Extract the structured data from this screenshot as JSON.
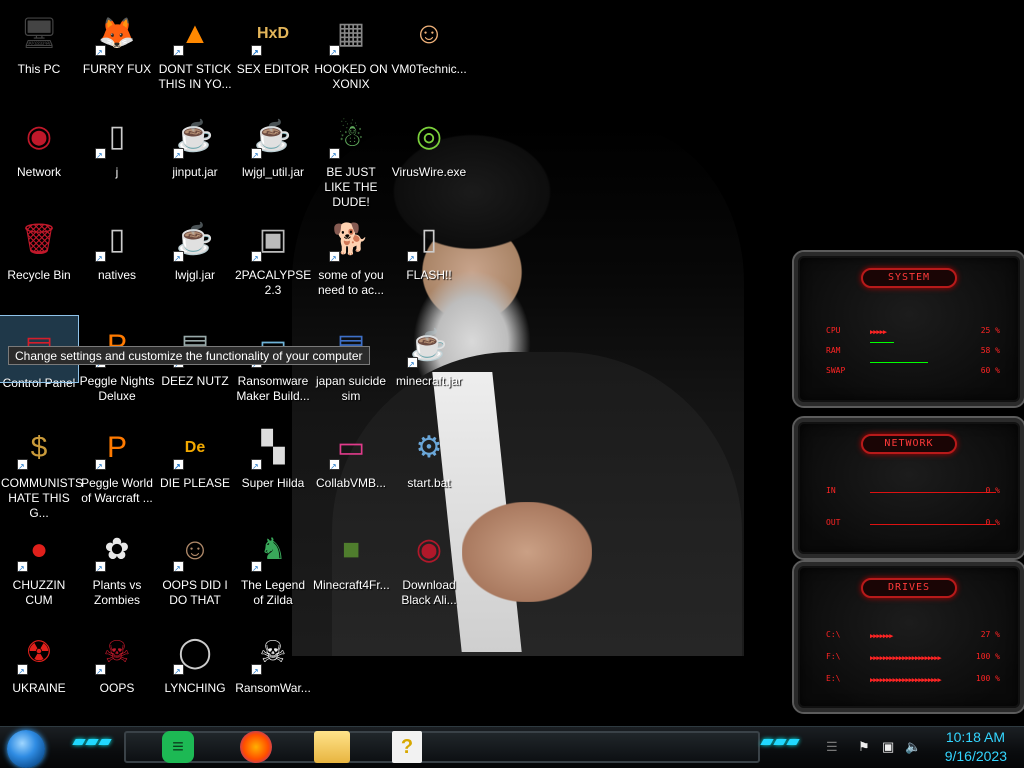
{
  "desktop": {
    "icons": [
      {
        "label": "This PC",
        "icon": "computer-icon"
      },
      {
        "label": "FURRY FUX",
        "icon": "firefox-icon"
      },
      {
        "label": "DONT STICK THIS IN YO...",
        "icon": "vlc-cone-icon"
      },
      {
        "label": "SEX EDITOR",
        "icon": "hex-editor-icon"
      },
      {
        "label": "HOOKED ON XONIX",
        "icon": "xonix-icon"
      },
      {
        "label": "VM0Technic...",
        "icon": "doctor-icon"
      },
      {
        "label": "Network",
        "icon": "network-icon"
      },
      {
        "label": "j",
        "icon": "file-icon"
      },
      {
        "label": "jinput.jar",
        "icon": "java-icon"
      },
      {
        "label": "lwjgl_util.jar",
        "icon": "java-icon"
      },
      {
        "label": "BE JUST LIKE THE DUDE!",
        "icon": "elf-icon"
      },
      {
        "label": "VirusWire.exe",
        "icon": "limewire-icon"
      },
      {
        "label": "Recycle Bin",
        "icon": "recycle-bin-icon"
      },
      {
        "label": "natives",
        "icon": "file-icon"
      },
      {
        "label": "lwjgl.jar",
        "icon": "java-icon"
      },
      {
        "label": "2PACALYPSE 2.3",
        "icon": "terminal-icon"
      },
      {
        "label": "some of you need to ac...",
        "icon": "dog-icon"
      },
      {
        "label": "FLASH!!",
        "icon": "file-icon"
      },
      {
        "label": "Control Panel",
        "icon": "control-panel-icon"
      },
      {
        "label": "Peggle Nights Deluxe",
        "icon": "peggle-icon"
      },
      {
        "label": "DEEZ NUTZ",
        "icon": "folder-stack-icon"
      },
      {
        "label": "Ransomware Maker Build...",
        "icon": "window-icon"
      },
      {
        "label": "japan suicide sim",
        "icon": "document-icon"
      },
      {
        "label": "minecraft.jar",
        "icon": "java-icon"
      },
      {
        "label": "COMMUNISTS HATE THIS G...",
        "icon": "money-bag-icon"
      },
      {
        "label": "Peggle World of Warcraft ...",
        "icon": "peggle-icon"
      },
      {
        "label": "DIE PLEASE",
        "icon": "die-logo-icon"
      },
      {
        "label": "Super Hilda",
        "icon": "pixel-game-icon"
      },
      {
        "label": "CollabVMB...",
        "icon": "monitor-icon"
      },
      {
        "label": "start.bat",
        "icon": "batch-gear-icon"
      },
      {
        "label": "CHUZZIN CUM",
        "icon": "chuzzle-icon"
      },
      {
        "label": "Plants vs Zombies",
        "icon": "plant-icon"
      },
      {
        "label": "OOPS DID I DO THAT",
        "icon": "portrait-icon"
      },
      {
        "label": "The Legend of Zilda",
        "icon": "link-icon"
      },
      {
        "label": "Minecraft4Fr...",
        "icon": "grass-block-icon"
      },
      {
        "label": "Download Black Ali...",
        "icon": "alienware-icon"
      },
      {
        "label": "UKRAINE",
        "icon": "radiation-icon"
      },
      {
        "label": "OOPS",
        "icon": "skull-monitor-icon"
      },
      {
        "label": "LYNCHING",
        "icon": "rope-icon"
      },
      {
        "label": "RansomWar...",
        "icon": "skull-icon"
      }
    ],
    "tooltip": "Change settings and customize the functionality of your computer"
  },
  "widget": {
    "system": {
      "title": "SYSTEM",
      "rows": [
        {
          "key": "CPU",
          "value": "25 %",
          "percent": 25
        },
        {
          "key": "RAM",
          "value": "58 %",
          "percent": 58
        },
        {
          "key": "SWAP",
          "value": "60 %",
          "percent": 60
        }
      ]
    },
    "network": {
      "title": "NETWORK",
      "rows": [
        {
          "key": "IN",
          "value": "0 %"
        },
        {
          "key": "OUT",
          "value": "0 %"
        }
      ]
    },
    "drives": {
      "title": "DRIVES",
      "rows": [
        {
          "key": "C:\\",
          "value": "27 %",
          "percent": 27
        },
        {
          "key": "F:\\",
          "value": "100 %",
          "percent": 100
        },
        {
          "key": "E:\\",
          "value": "100 %",
          "percent": 100
        }
      ]
    }
  },
  "taskbar": {
    "apps": [
      {
        "name": "notes-app-icon"
      },
      {
        "name": "firefox-icon"
      },
      {
        "name": "file-explorer-icon"
      },
      {
        "name": "help-document-icon"
      }
    ],
    "tray": [
      {
        "name": "flag-icon"
      },
      {
        "name": "network-tray-icon"
      },
      {
        "name": "volume-icon"
      }
    ],
    "clock": {
      "time": "10:18 AM",
      "date": "9/16/2023"
    },
    "accent": "#33d6ff"
  }
}
